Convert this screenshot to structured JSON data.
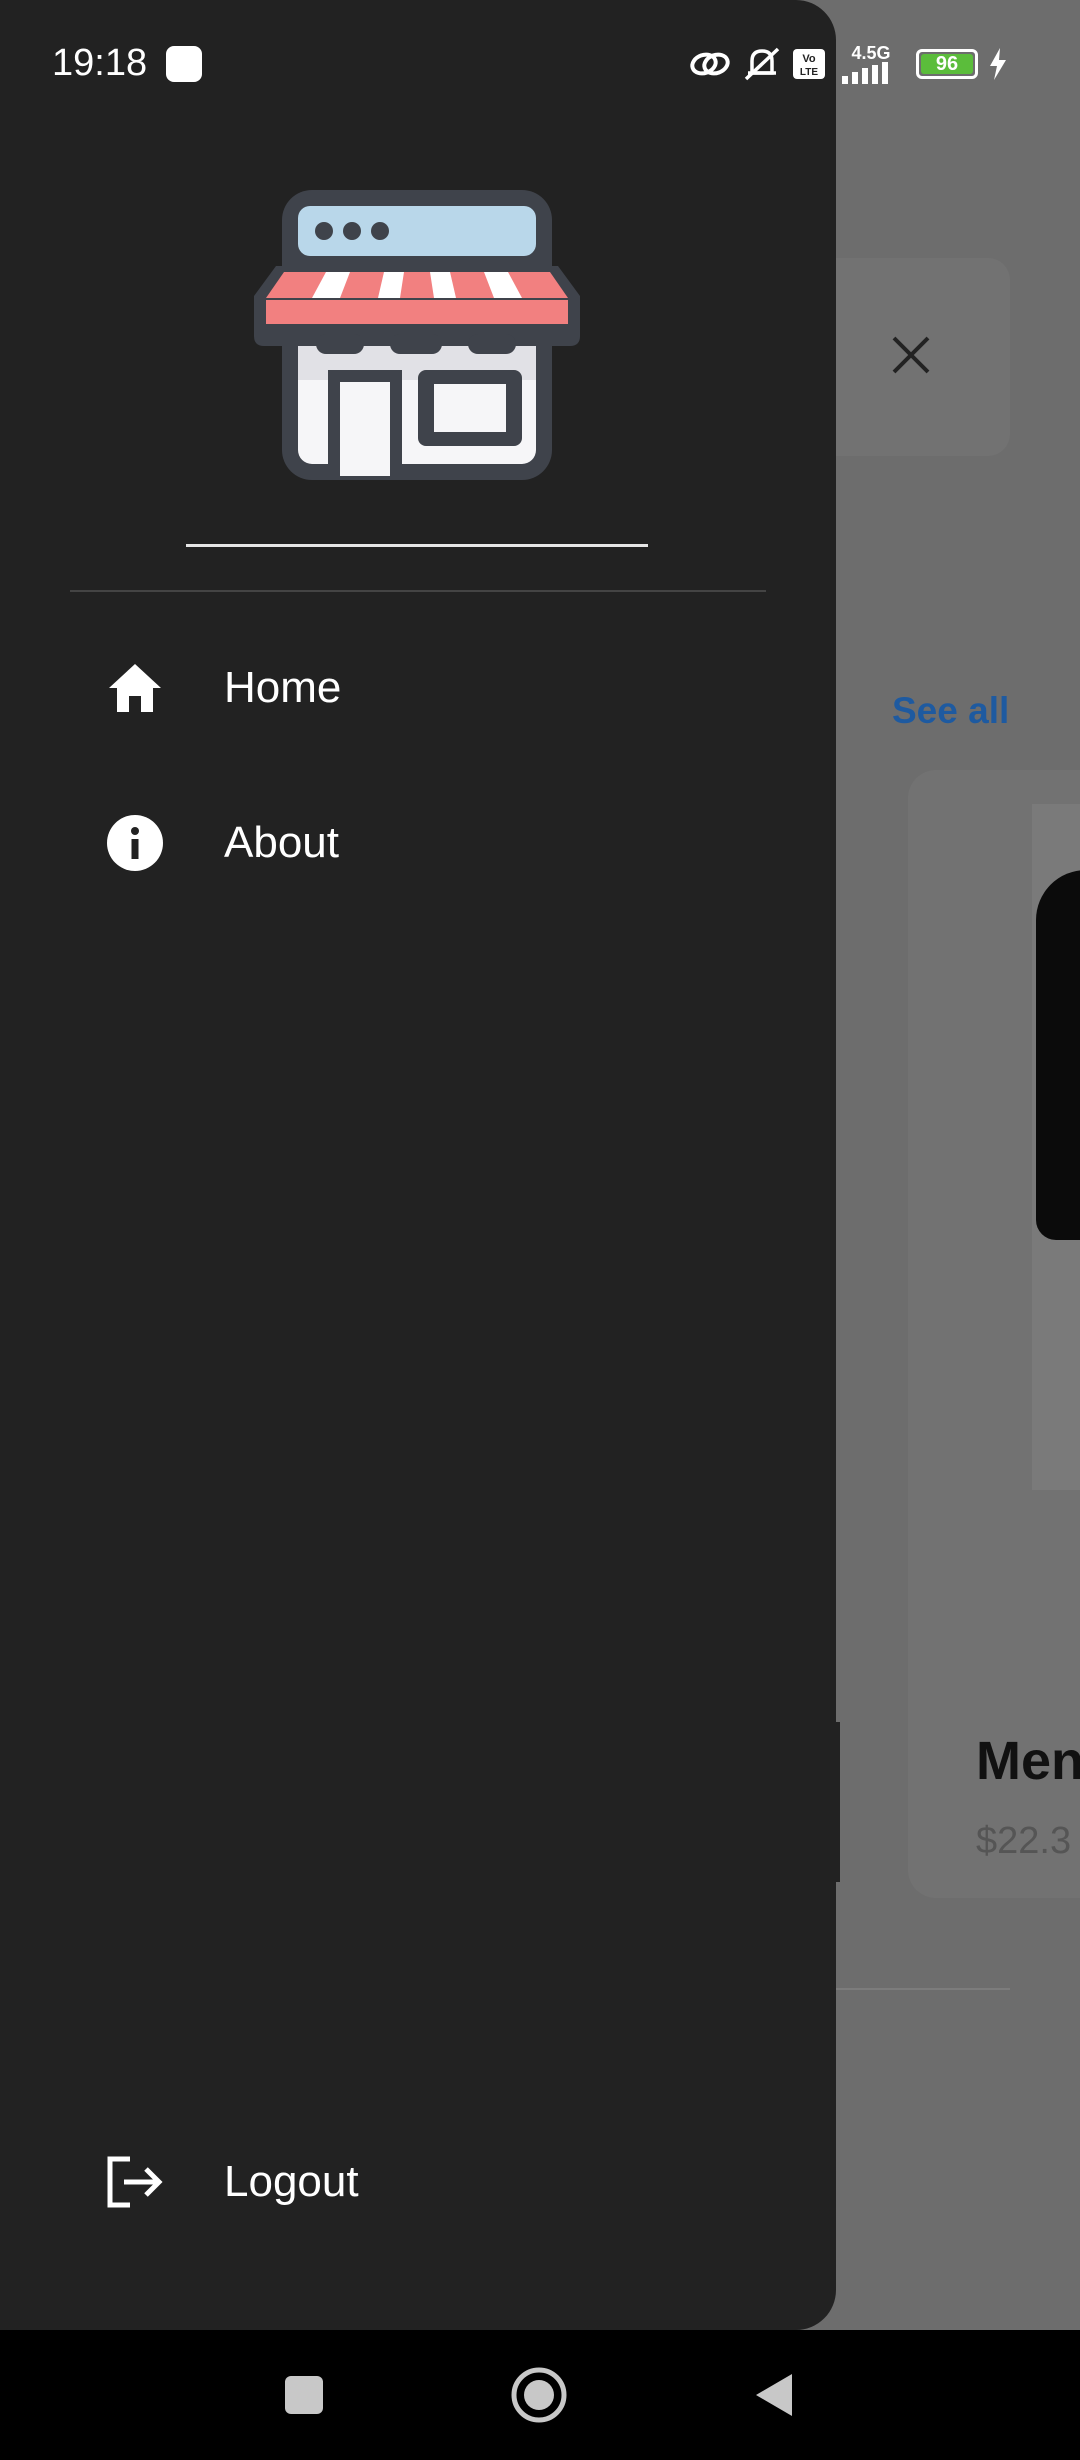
{
  "status_bar": {
    "time": "19:18",
    "battery_level": "96",
    "network": "4.5G",
    "volte": "Vo LTE",
    "icons": [
      "link-icon",
      "mute-icon",
      "volte-icon",
      "signal-icon",
      "battery-icon",
      "charging-icon"
    ]
  },
  "drawer": {
    "logo_icon": "store-icon",
    "menu": {
      "home_label": "Home",
      "about_label": "About",
      "logout_label": "Logout"
    }
  },
  "background": {
    "see_all_label": "See all",
    "product_title": "Men",
    "product_price": "$22.3"
  },
  "colors": {
    "drawer_bg": "#222222",
    "accent_link": "#1e5aa0",
    "awning_red": "#f28080",
    "window_blue": "#b9d7ea",
    "battery_green": "#5bbd3b"
  }
}
